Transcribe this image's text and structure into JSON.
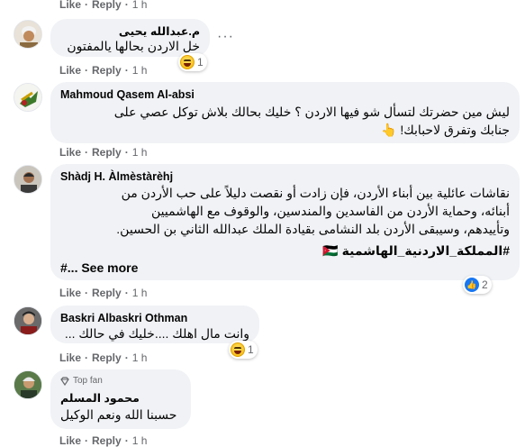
{
  "common": {
    "like": "Like",
    "reply": "Reply",
    "sep": "·"
  },
  "top_actions": {
    "time": "1 h"
  },
  "comments": [
    {
      "author": "م.عبدالله يحيى",
      "text": "خل الاردن بحالها يالمفتون",
      "time": "1 h",
      "reaction_count": "1",
      "more": "···"
    },
    {
      "author": "Mahmoud Qasem Al-absi",
      "line1": "ليش مين حضرتك لتسأل شو فيها الاردن ؟ خليك بحالك بلاش توكل عصي على",
      "line2": "جنابك وتفرق لاحبابك! 👆",
      "time": "1 h"
    },
    {
      "author": "Shàdj H. Àlmèstàrèhj",
      "line1": "نقاشات عائلية بين أبناء الأردن، فإن زادت أو نقصت دليلاً على حب الأردن من",
      "line2": "أبنائه، وحماية الأردن من الفاسدين والمندسين، والوقوف مع الهاشميين",
      "line3": "وتأييدهم، وسيبقى الأردن بلد النشامى بقيادة الملك عبدالله الثاني بن الحسين.",
      "hashtag": "#المملكة_الاردنية_الهاشمية 🇯🇴",
      "see_more": "#... See more",
      "time": "1 h",
      "reaction_count": "2"
    },
    {
      "author": "Baskri Albaskri Othman",
      "text": "وانت مال اهلك ....خليك في حالك ...",
      "time": "1 h",
      "reaction_count": "1"
    },
    {
      "badge": "Top fan",
      "author": "محمود المسلم",
      "text": "حسبنا الله ونعم الوكيل",
      "time": "1 h"
    }
  ],
  "colors": {
    "bubble": "#f0f2f5",
    "meta": "#65676b",
    "like_blue": "#1877f2",
    "haha_yellow": "#f7c331"
  },
  "icons": [
    "haha-reaction-icon",
    "like-reaction-icon",
    "more-options-icon",
    "top-fan-diamond-icon"
  ]
}
